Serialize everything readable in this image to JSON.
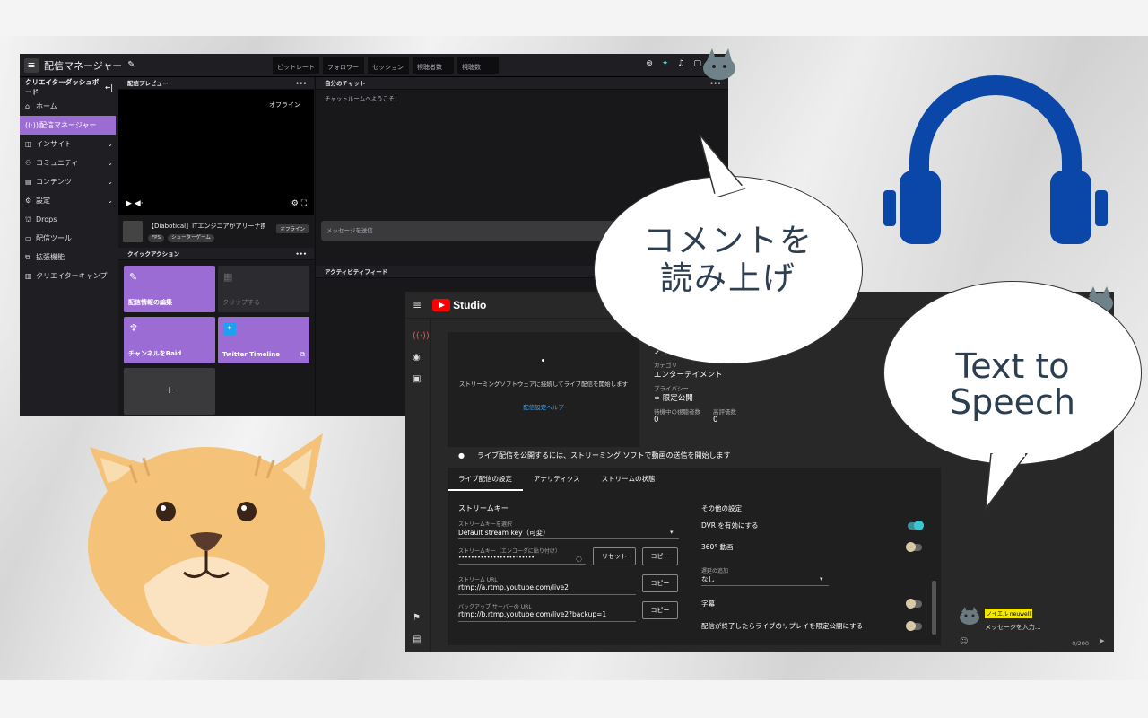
{
  "twitch": {
    "title": "配信マネージャー",
    "stats": [
      "ビットレート",
      "フォロワー",
      "セッション",
      "視聴者数",
      "視聴数"
    ],
    "sidebar_heading": "クリエイターダッシュボード",
    "nav": [
      {
        "label": "ホーム",
        "icon": "home-icon",
        "chev": ""
      },
      {
        "label": "配信マネージャー",
        "icon": "broadcast-icon",
        "chev": ""
      },
      {
        "label": "インサイト",
        "icon": "insights-icon",
        "chev": "⌄"
      },
      {
        "label": "コミュニティ",
        "icon": "community-icon",
        "chev": "⌄"
      },
      {
        "label": "コンテンツ",
        "icon": "content-icon",
        "chev": "⌄"
      },
      {
        "label": "設定",
        "icon": "settings-icon",
        "chev": "⌄"
      },
      {
        "label": "Drops",
        "icon": "drops-icon",
        "chev": ""
      },
      {
        "label": "配信ツール",
        "icon": "stream-tools-icon",
        "chev": ""
      },
      {
        "label": "拡張機能",
        "icon": "extensions-icon",
        "chev": ""
      },
      {
        "label": "クリエイターキャンプ",
        "icon": "creator-camp-icon",
        "chev": ""
      }
    ],
    "preview_heading": "配信プレビュー",
    "offline_text": "オフライン",
    "stream_title": "【Diabotical】ITエンジニアがアリーナ携...",
    "tags": [
      "FPS",
      "シューターゲーム"
    ],
    "offline_badge": "オフライン",
    "quick_actions_heading": "クイックアクション",
    "quick_actions": [
      {
        "label": "配信情報の編集",
        "color": "#9b6dd4"
      },
      {
        "label": "クリップする",
        "color": "#2c2c30"
      },
      {
        "label": "チャンネルをRaid",
        "color": "#9b6dd4"
      },
      {
        "label": "Twitter Timeline",
        "color": "#9b6dd4"
      },
      {
        "label": "+",
        "color": "#3a3a3d"
      }
    ],
    "chat_heading": "自分のチャット",
    "chat_welcome": "チャットルームへようこそ！",
    "chat_placeholder": "メッセージを送信",
    "activity_heading": "アクティビティフィード"
  },
  "youtube": {
    "brand": "Studio",
    "preview_text": "ストリーミングソフトウェアに接続してライブ配信を開始します",
    "preview_link": "配信設定ヘルプ",
    "meta": {
      "title_value": "ノイエル",
      "category_label": "カテゴリ",
      "category_value": "エンターテイメント",
      "privacy_label": "プライバシー",
      "privacy_value": "∞ 限定公開",
      "waiting_label": "待機中の視聴者数",
      "waiting_value": "0",
      "likes_label": "高評価数",
      "likes_value": "0"
    },
    "warning": "ライブ配信を公開するには、ストリーミング ソフトで動画の送信を開始します",
    "tabs": [
      "ライブ配信の設定",
      "アナリティクス",
      "ストリームの状態"
    ],
    "stream_key_section": "ストリームキー",
    "select_key_label": "ストリームキーを選択",
    "select_key_value": "Default stream key（可変）",
    "key_label": "ストリームキー（エンコーダに貼り付け）",
    "key_value": "••••••••••••••••••••••••",
    "reset_button": "リセット",
    "copy_button": "コピー",
    "url_label": "ストリーム URL",
    "url_value": "rtmp://a.rtmp.youtube.com/live2",
    "backup_label": "バックアップ サーバーの URL",
    "backup_value": "rtmp://b.rtmp.youtube.com/live2?backup=1",
    "other_section": "その他の設定",
    "dvr_label": "DVR を有効にする",
    "vr_label": "360° 動画",
    "delay_label": "遅延の追加",
    "delay_value": "なし",
    "captions_label": "字幕",
    "replay_label": "配信が終了したらライブのリプレイを限定公開にする",
    "chat_name": "ノイエル neuwell",
    "chat_placeholder": "メッセージを入力...",
    "chat_count": "0/200"
  },
  "bubbles": {
    "ja_line1": "コメントを",
    "ja_line2": "読み上げ",
    "en_line1": "Text to",
    "en_line2": "Speech"
  },
  "colors": {
    "twitch_purple": "#9b6dd4",
    "youtube_red": "#ff0000",
    "headphone_blue": "#0b47a8",
    "cat_orange": "#f5c27a"
  }
}
